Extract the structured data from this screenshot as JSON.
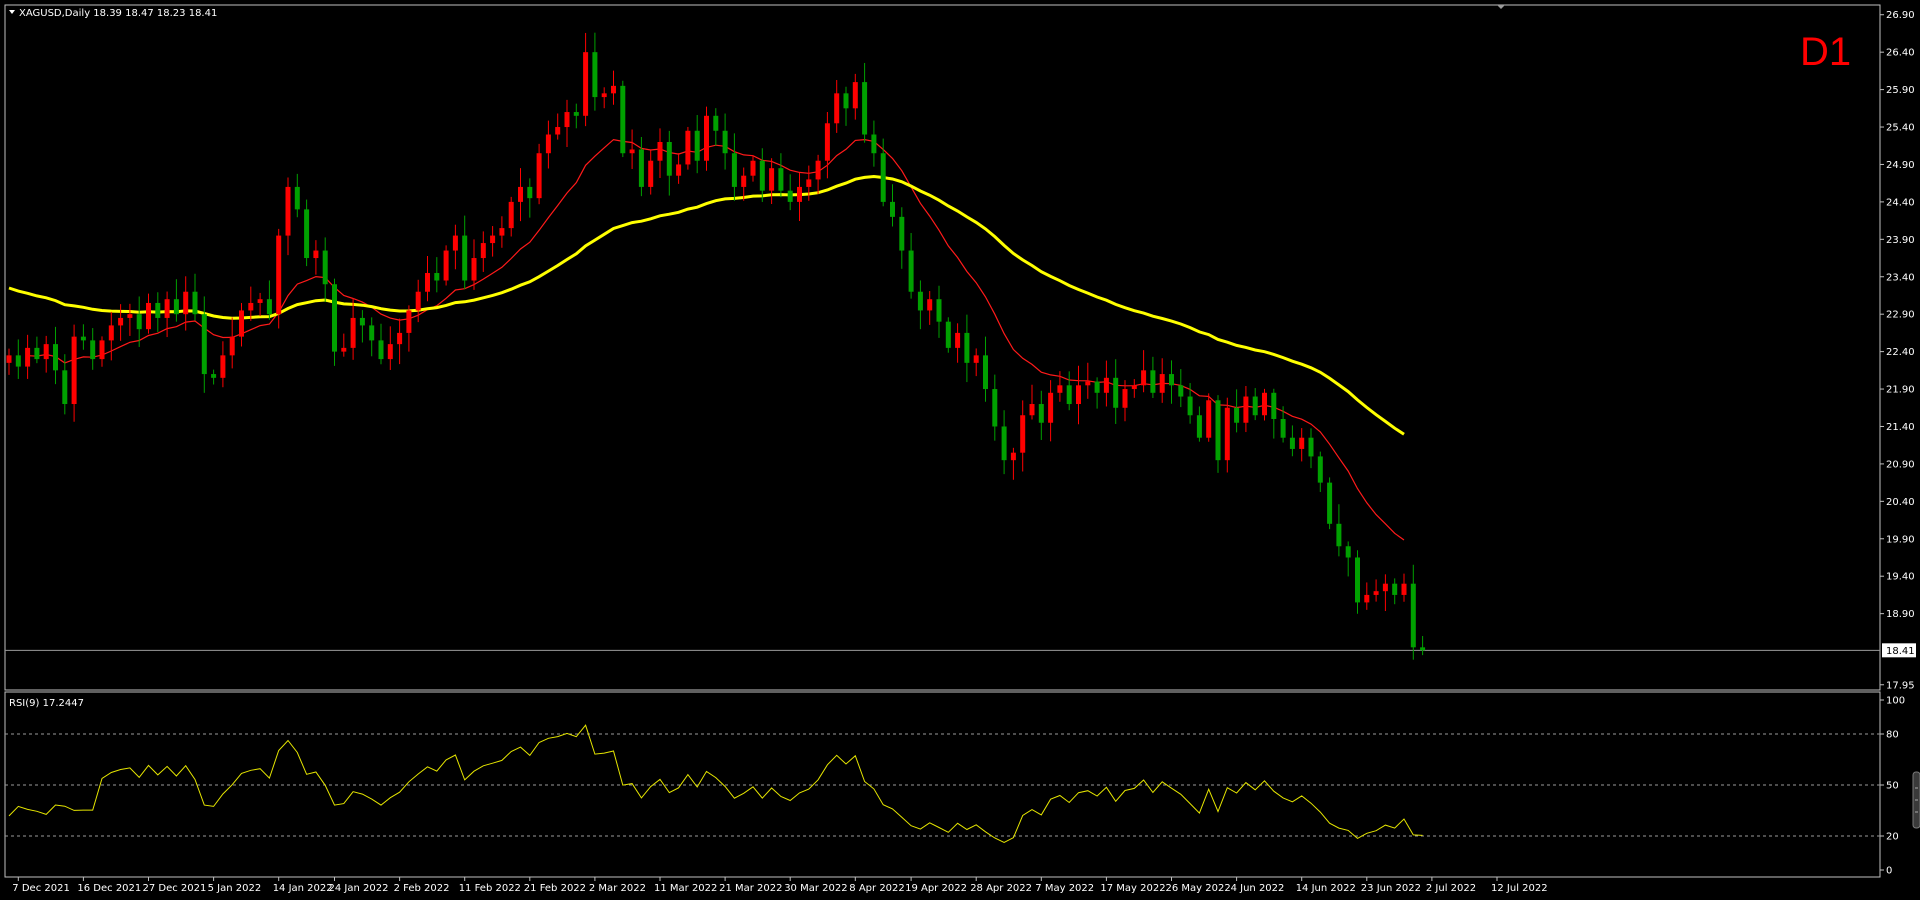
{
  "header": {
    "symbol_line": "XAGUSD,Daily  18.39 18.47 18.23 18.41",
    "timeframe_badge": "D1"
  },
  "colors": {
    "background": "#000000",
    "frame": "#c0c0c0",
    "bull_candle": "#ff0000",
    "bear_candle": "#00a000",
    "ma_fast": "#ff1a1a",
    "ma_slow": "#ffff00",
    "rsi_line": "#e5e500",
    "price_line": "#9a9a9a"
  },
  "chart_data": [
    {
      "type": "candlestick",
      "title": "XAGUSD,Daily",
      "ohlc_readout": "18.39 18.47 18.23 18.41",
      "last_price_label": "18.41",
      "y_ticks": [
        "26.90",
        "26.40",
        "25.90",
        "25.40",
        "24.90",
        "24.40",
        "23.90",
        "23.40",
        "22.90",
        "22.40",
        "21.90",
        "21.40",
        "20.90",
        "20.40",
        "19.90",
        "19.40",
        "18.90",
        "17.95"
      ],
      "y_tick_values": [
        26.9,
        26.4,
        25.9,
        25.4,
        24.9,
        24.4,
        23.9,
        23.4,
        22.9,
        22.4,
        21.9,
        21.4,
        20.9,
        20.4,
        19.9,
        19.4,
        18.9,
        17.95
      ],
      "ylim": [
        17.88,
        27.03
      ],
      "x_ticks": [
        {
          "label": "7 Dec 2021",
          "index": 1
        },
        {
          "label": "16 Dec 2021",
          "index": 8
        },
        {
          "label": "27 Dec 2021",
          "index": 15
        },
        {
          "label": "5 Jan 2022",
          "index": 22
        },
        {
          "label": "14 Jan 2022",
          "index": 29
        },
        {
          "label": "24 Jan 2022",
          "index": 35
        },
        {
          "label": "2 Feb 2022",
          "index": 42
        },
        {
          "label": "11 Feb 2022",
          "index": 49
        },
        {
          "label": "21 Feb 2022",
          "index": 56
        },
        {
          "label": "2 Mar 2022",
          "index": 63
        },
        {
          "label": "11 Mar 2022",
          "index": 70
        },
        {
          "label": "21 Mar 2022",
          "index": 77
        },
        {
          "label": "30 Mar 2022",
          "index": 84
        },
        {
          "label": "8 Apr 2022",
          "index": 91
        },
        {
          "label": "19 Apr 2022",
          "index": 97
        },
        {
          "label": "28 Apr 2022",
          "index": 104
        },
        {
          "label": "7 May 2022",
          "index": 111
        },
        {
          "label": "17 May 2022",
          "index": 118
        },
        {
          "label": "26 May 2022",
          "index": 125
        },
        {
          "label": "4 Jun 2022",
          "index": 132
        },
        {
          "label": "14 Jun 2022",
          "index": 139
        },
        {
          "label": "23 Jun 2022",
          "index": 146
        },
        {
          "label": "2 Jul 2022",
          "index": 153
        },
        {
          "label": "12 Jul 2022",
          "index": 160
        }
      ],
      "close": [
        22.35,
        22.2,
        22.45,
        22.3,
        22.5,
        22.15,
        21.7,
        22.6,
        22.55,
        22.3,
        22.55,
        22.75,
        22.85,
        22.9,
        22.7,
        23.05,
        22.85,
        23.1,
        22.9,
        23.2,
        22.9,
        22.1,
        22.05,
        22.35,
        22.6,
        22.95,
        23.05,
        23.1,
        22.9,
        23.95,
        24.6,
        24.3,
        23.65,
        23.75,
        23.3,
        22.4,
        22.45,
        22.85,
        22.75,
        22.55,
        22.3,
        22.5,
        22.65,
        22.95,
        23.2,
        23.45,
        23.35,
        23.75,
        23.95,
        23.35,
        23.65,
        23.85,
        23.95,
        24.05,
        24.4,
        24.6,
        24.45,
        25.05,
        25.3,
        25.4,
        25.6,
        25.55,
        26.4,
        25.8,
        25.85,
        25.95,
        25.05,
        25.1,
        24.6,
        24.95,
        25.2,
        24.75,
        24.9,
        25.35,
        24.95,
        25.55,
        25.35,
        25.05,
        24.6,
        24.75,
        24.95,
        24.55,
        24.85,
        24.55,
        24.4,
        24.6,
        24.7,
        24.95,
        25.45,
        25.85,
        25.65,
        26.0,
        25.3,
        25.05,
        24.4,
        24.2,
        23.75,
        23.2,
        22.95,
        23.1,
        22.8,
        22.45,
        22.65,
        22.25,
        22.35,
        21.9,
        21.4,
        20.95,
        21.05,
        21.55,
        21.7,
        21.45,
        21.85,
        21.95,
        21.7,
        21.95,
        22.0,
        21.85,
        22.05,
        21.65,
        21.9,
        21.95,
        22.15,
        21.85,
        22.1,
        21.95,
        21.8,
        21.55,
        21.25,
        21.75,
        20.95,
        21.65,
        21.45,
        21.8,
        21.55,
        21.85,
        21.5,
        21.25,
        21.1,
        21.25,
        21.0,
        20.65,
        20.1,
        19.8,
        19.65,
        19.05,
        19.15,
        19.2,
        19.3,
        19.15,
        19.3,
        18.45,
        18.41
      ],
      "series": [
        {
          "name": "",
          "kind": "moving_average_fast"
        },
        {
          "name": "",
          "kind": "moving_average_slow"
        }
      ]
    },
    {
      "type": "line",
      "title": "RSI(9) 17.2447",
      "ylim": [
        0,
        100
      ],
      "y_ticks": [
        "100",
        "80",
        "50",
        "20",
        "0"
      ],
      "y_tick_values": [
        100,
        80,
        50,
        20,
        0
      ],
      "levels": [
        80,
        50,
        20
      ]
    }
  ]
}
